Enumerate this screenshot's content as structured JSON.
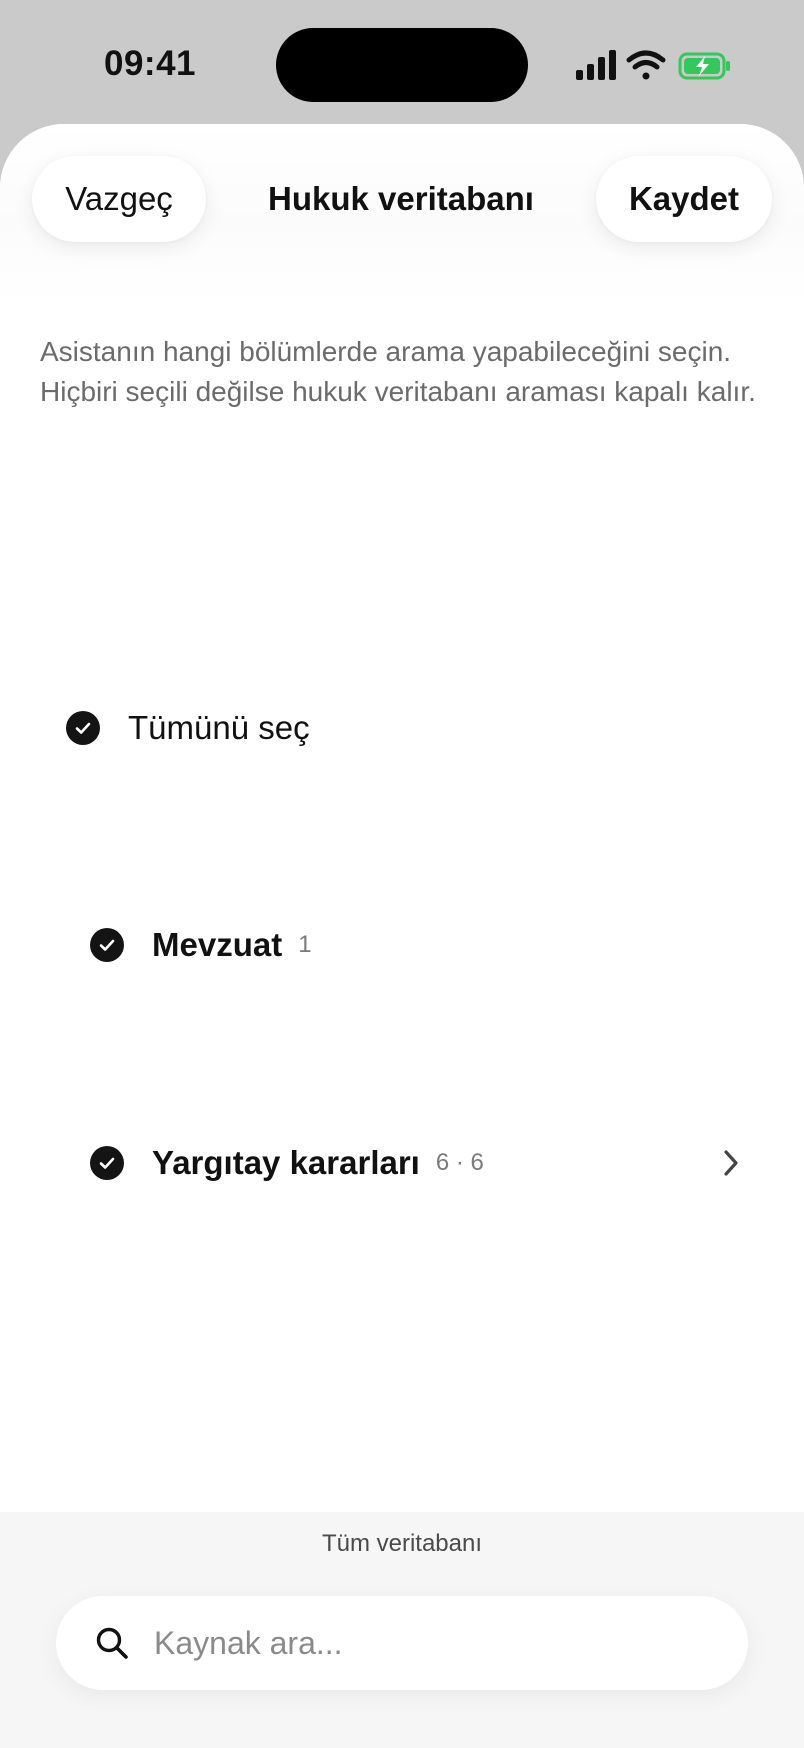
{
  "status_bar": {
    "time": "09:41",
    "battery_color": "#34c759"
  },
  "header": {
    "cancel_label": "Vazgeç",
    "title": "Hukuk veritabanı",
    "save_label": "Kaydet"
  },
  "description": "Asistanın hangi bölümlerde arama yapabileceğini seçin. Hiçbiri seçili değilse hukuk veritabanı araması kapalı kalır.",
  "options": {
    "select_all": {
      "label": "Tümünü seç",
      "checked": true
    },
    "items": [
      {
        "label": "Mevzuat",
        "count": "1",
        "checked": true
      },
      {
        "label": "Yargıtay kararları",
        "count": "6 · 6",
        "checked": true
      }
    ]
  },
  "footer": {
    "scope_label": "Tüm veritabanı",
    "search_placeholder": "Kaynak ara..."
  }
}
